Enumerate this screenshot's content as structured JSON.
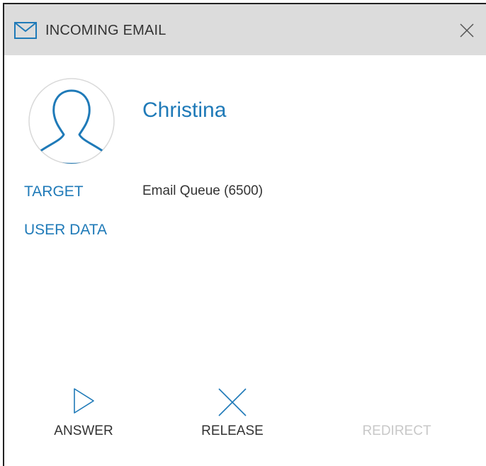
{
  "header": {
    "title": "INCOMING EMAIL",
    "icon": "mail-icon",
    "close_icon": "close-icon"
  },
  "caller": {
    "name": "Christina",
    "avatar_icon": "user-avatar-icon"
  },
  "details": {
    "target_label": "TARGET",
    "target_value": "Email Queue (6500)",
    "user_data_label": "USER DATA"
  },
  "actions": {
    "answer_label": "ANSWER",
    "release_label": "RELEASE",
    "redirect_label": "REDIRECT"
  },
  "colors": {
    "accent": "#1f7ab8",
    "header_bg": "#dcdcdc",
    "disabled_text": "#c8c8c8"
  }
}
